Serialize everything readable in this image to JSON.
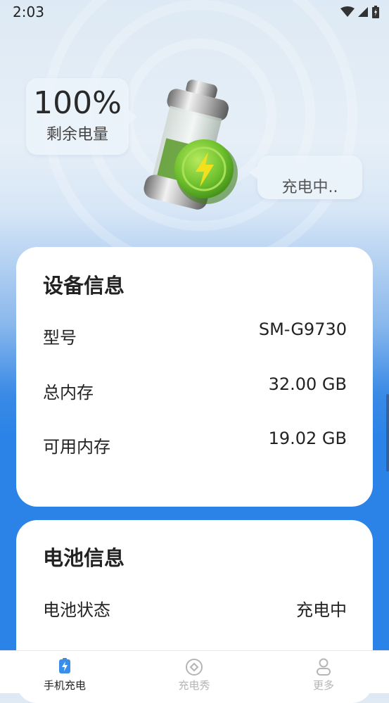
{
  "status_bar": {
    "time": "2:03"
  },
  "hero": {
    "battery_percent": "100%",
    "remaining_label": "剩余电量",
    "charging_status": "充电中.."
  },
  "device_info": {
    "title": "设备信息",
    "rows": [
      {
        "label": "型号",
        "value": "SM-G9730"
      },
      {
        "label": "总内存",
        "value": "32.00 GB"
      },
      {
        "label": "可用内存",
        "value": "19.02 GB"
      }
    ]
  },
  "battery_info": {
    "title": "电池信息",
    "rows": [
      {
        "label": "电池状态",
        "value": "充电中"
      }
    ]
  },
  "tab_bar": {
    "tabs": [
      {
        "label": "手机充电",
        "icon": "battery-charge-icon",
        "active": true
      },
      {
        "label": "充电秀",
        "icon": "diamond-circle-icon",
        "active": false
      },
      {
        "label": "更多",
        "icon": "person-icon",
        "active": false
      }
    ]
  },
  "colors": {
    "accent": "#2b83e7",
    "active_tab_text": "#222222",
    "inactive_tab_text": "#b5b5b5",
    "charge_green": "#7cc63a"
  }
}
